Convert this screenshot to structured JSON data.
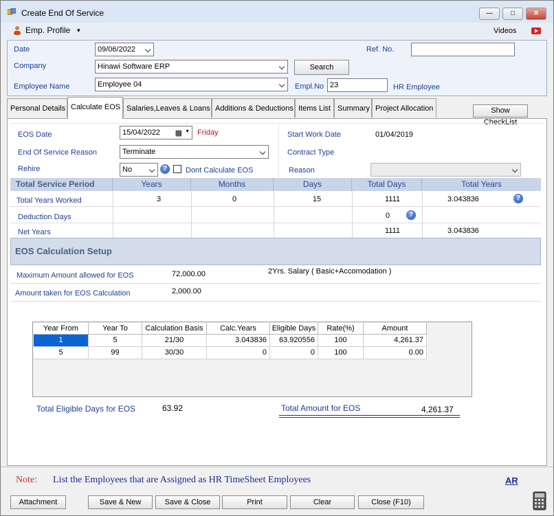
{
  "window": {
    "title": "Create End Of Service"
  },
  "menu": {
    "emp_profile": "Emp. Profile",
    "videos": "Videos"
  },
  "header": {
    "date_label": "Date",
    "date_value": "09/06/2022",
    "ref_label": "Ref. No.",
    "ref_value": "",
    "company_label": "Company",
    "company_value": "Hinawi Software ERP",
    "search_label": "Search",
    "employee_label": "Employee Name",
    "employee_value": "Employee 04",
    "emplno_label": "Empl.No",
    "emplno_value": "23",
    "hr_employee": "HR Employee"
  },
  "tabs": [
    {
      "label": "Personal Details"
    },
    {
      "label": "Calculate EOS"
    },
    {
      "label": "Salaries,Leaves & Loans"
    },
    {
      "label": "Additions & Deductions"
    },
    {
      "label": "Items List"
    },
    {
      "label": "Summary"
    },
    {
      "label": "Project Allocation"
    }
  ],
  "show_checklist": "Show CheckList",
  "eos": {
    "eos_date_label": "EOS Date",
    "eos_date_value": "15/04/2022",
    "eos_day": "Friday",
    "start_work_label": "Start Work Date",
    "start_work_value": "01/04/2019",
    "reason_label": "End Of Service Reason",
    "reason_value": "Terminate",
    "contract_type_label": "Contract Type",
    "rehire_label": "Rehire",
    "rehire_value": "No",
    "dont_calc_label": "Dont Calculate EOS",
    "reason2_label": "Reason",
    "reason2_value": ""
  },
  "service": {
    "headers": [
      "Total Service Period",
      "Years",
      "Months",
      "Days",
      "Total Days",
      "Total Years"
    ],
    "rows": [
      {
        "label": "Total Years Worked",
        "years": "3",
        "months": "0",
        "days": "15",
        "total_days": "1111",
        "total_years": "3.043836"
      },
      {
        "label": "Deduction Days",
        "years": "",
        "months": "",
        "days": "",
        "total_days": "0",
        "total_years": ""
      },
      {
        "label": "Net Years",
        "years": "",
        "months": "",
        "days": "",
        "total_days": "1111",
        "total_years": "3.043836"
      }
    ]
  },
  "setup": {
    "title": "EOS Calculation Setup",
    "max_label": "Maximum Amount allowed for EOS",
    "max_value": "72,000.00",
    "max_note": "2Yrs. Salary ( Basic+Accomodation )",
    "taken_label": "Amount taken for EOS Calculation",
    "taken_value": "2,000.00"
  },
  "calc_table": {
    "headers": [
      "Year From",
      "Year To",
      "Calculation Basis",
      "Calc.Years",
      "Eligible Days",
      "Rate(%)",
      "Amount"
    ],
    "rows": [
      [
        "1",
        "5",
        "21/30",
        "3.043836",
        "63.920556",
        "100",
        "4,261.37"
      ],
      [
        "5",
        "99",
        "30/30",
        "0",
        "0",
        "100",
        "0.00"
      ]
    ]
  },
  "totals": {
    "eligible_label": "Total Eligible Days for EOS",
    "eligible_value": "63.92",
    "amount_label": "Total Amount for EOS",
    "amount_value": "4,261.37"
  },
  "note": {
    "label": "Note:",
    "text": "List the Employees that are Assigned as HR  TimeSheet Employees",
    "link": "AR"
  },
  "footer": {
    "attachment": "Attachment",
    "save_new": "Save & New",
    "save_close": "Save & Close",
    "print": "Print",
    "clear": "Clear",
    "close": "Close (F10)"
  }
}
